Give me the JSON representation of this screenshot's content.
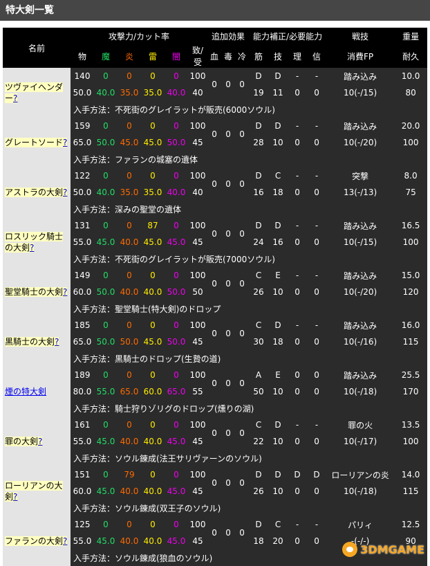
{
  "page": {
    "title": "特大剣一覧"
  },
  "header": {
    "name": "名前",
    "attack_group": "攻撃力/カット率",
    "effect_group": "追加効果",
    "stat_group": "能力補正/必要能力",
    "skill": "戦技",
    "weight": "重量",
    "attack_cols": [
      "物",
      "魔",
      "炎",
      "雷",
      "闇",
      "致/受"
    ],
    "effect_cols": [
      "血",
      "毒",
      "冷"
    ],
    "stat_cols": [
      "筋",
      "技",
      "理",
      "信"
    ],
    "skill_sub": "消費FP",
    "weight_sub": "耐久"
  },
  "weapons": [
    {
      "name": "ツヴァイヘンダー",
      "q": "?",
      "r1": [
        "140",
        "0",
        "0",
        "0",
        "0",
        "100"
      ],
      "eff": [
        "0",
        "0",
        "0"
      ],
      "s1": [
        "D",
        "D",
        "-",
        "-"
      ],
      "skill": "踏み込み",
      "weight": "10.0",
      "r2": [
        "50.0",
        "40.0",
        "35.0",
        "35.0",
        "40.0",
        "40"
      ],
      "s2": [
        "19",
        "11",
        "0",
        "0"
      ],
      "fp": "10(-/15)",
      "dur": "80",
      "acq": "入手方法：不死街のグレイラットが販売(6000ソウル)"
    },
    {
      "name": "グレートソード",
      "q": "?",
      "r1": [
        "159",
        "0",
        "0",
        "0",
        "0",
        "100"
      ],
      "eff": [
        "0",
        "0",
        "0"
      ],
      "s1": [
        "D",
        "D",
        "-",
        "-"
      ],
      "skill": "踏み込み",
      "weight": "20.0",
      "r2": [
        "65.0",
        "50.0",
        "45.0",
        "45.0",
        "50.0",
        "45"
      ],
      "s2": [
        "28",
        "10",
        "0",
        "0"
      ],
      "fp": "10(-/20)",
      "dur": "100",
      "acq": "入手方法：ファランの城塞の遺体"
    },
    {
      "name": "アストラの大剣",
      "q": "?",
      "r1": [
        "122",
        "0",
        "0",
        "0",
        "0",
        "100"
      ],
      "eff": [
        "0",
        "0",
        "0"
      ],
      "s1": [
        "D",
        "C",
        "-",
        "-"
      ],
      "skill": "突撃",
      "weight": "8.0",
      "r2": [
        "50.0",
        "40.0",
        "35.0",
        "35.0",
        "40.0",
        "40"
      ],
      "s2": [
        "16",
        "18",
        "0",
        "0"
      ],
      "fp": "13(-/13)",
      "dur": "75",
      "acq": "入手方法：深みの聖堂の遺体"
    },
    {
      "name": "ロスリック騎士の大剣",
      "q": "?",
      "r1": [
        "131",
        "0",
        "0",
        "87",
        "0",
        "100"
      ],
      "eff": [
        "0",
        "0",
        "0"
      ],
      "s1": [
        "D",
        "D",
        "-",
        "-"
      ],
      "skill": "踏み込み",
      "weight": "16.5",
      "r2": [
        "55.0",
        "45.0",
        "40.0",
        "45.0",
        "45.0",
        "45"
      ],
      "s2": [
        "24",
        "16",
        "0",
        "0"
      ],
      "fp": "10(-/15)",
      "dur": "100",
      "acq": "入手方法：不死街のグレイラットが販売(7000ソウル)"
    },
    {
      "name": "聖堂騎士の大剣",
      "q": "?",
      "r1": [
        "149",
        "0",
        "0",
        "0",
        "0",
        "100"
      ],
      "eff": [
        "0",
        "0",
        "0"
      ],
      "s1": [
        "C",
        "E",
        "-",
        "-"
      ],
      "skill": "踏み込み",
      "weight": "15.0",
      "r2": [
        "60.0",
        "50.0",
        "40.0",
        "40.0",
        "50.0",
        "50"
      ],
      "s2": [
        "26",
        "10",
        "0",
        "0"
      ],
      "fp": "10(-/20)",
      "dur": "120",
      "acq": "入手方法：聖堂騎士(特大剣)のドロップ"
    },
    {
      "name": "黒騎士の大剣",
      "q": "?",
      "r1": [
        "185",
        "0",
        "0",
        "0",
        "0",
        "100"
      ],
      "eff": [
        "0",
        "0",
        "0"
      ],
      "s1": [
        "C",
        "D",
        "-",
        "-"
      ],
      "skill": "踏み込み",
      "weight": "16.0",
      "r2": [
        "65.0",
        "50.0",
        "50.0",
        "45.0",
        "50.0",
        "45"
      ],
      "s2": [
        "30",
        "18",
        "0",
        "0"
      ],
      "fp": "10(-/16)",
      "dur": "115",
      "acq": "入手方法：黒騎士のドロップ(生贄の道)"
    },
    {
      "name": "煙の特大剣",
      "q": "",
      "r1": [
        "189",
        "0",
        "0",
        "0",
        "0",
        "100"
      ],
      "eff": [
        "0",
        "0",
        "0"
      ],
      "s1": [
        "A",
        "E",
        "0",
        "0"
      ],
      "skill": "踏み込み",
      "weight": "25.5",
      "r2": [
        "80.0",
        "55.0",
        "65.0",
        "60.0",
        "65.0",
        "55"
      ],
      "s2": [
        "50",
        "10",
        "0",
        "0"
      ],
      "fp": "10(-/18)",
      "dur": "170",
      "acq": "入手方法：騎士狩りゾリグのドロップ(燻りの湖)"
    },
    {
      "name": "罪の大剣",
      "q": "?",
      "r1": [
        "161",
        "0",
        "0",
        "0",
        "0",
        "100"
      ],
      "eff": [
        "0",
        "0",
        "0"
      ],
      "s1": [
        "C",
        "D",
        "-",
        "-"
      ],
      "skill": "罪の火",
      "weight": "13.5",
      "r2": [
        "55.0",
        "45.0",
        "40.0",
        "40.0",
        "45.0",
        "45"
      ],
      "s2": [
        "22",
        "10",
        "0",
        "0"
      ],
      "fp": "10(-/17)",
      "dur": "100",
      "acq": "入手方法：ソウル錬成(法王サリヴァーンのソウル)"
    },
    {
      "name": "ローリアンの大剣",
      "q": "?",
      "r1": [
        "151",
        "0",
        "79",
        "0",
        "0",
        "100"
      ],
      "eff": [
        "0",
        "0",
        "0"
      ],
      "s1": [
        "D",
        "D",
        "D",
        "D"
      ],
      "skill": "ローリアンの炎",
      "weight": "14.0",
      "r2": [
        "60.0",
        "45.0",
        "40.0",
        "40.0",
        "45.0",
        "45"
      ],
      "s2": [
        "26",
        "10",
        "0",
        "0"
      ],
      "fp": "10(-/18)",
      "dur": "115",
      "acq": "入手方法：ソウル錬成(双王子のソウル)"
    },
    {
      "name": "ファランの大剣",
      "q": "?",
      "r1": [
        "125",
        "0",
        "0",
        "0",
        "0",
        "100"
      ],
      "eff": [
        "0",
        "0",
        "0"
      ],
      "s1": [
        "D",
        "C",
        "-",
        "-"
      ],
      "skill": "パリィ",
      "weight": "12.5",
      "r2": [
        "55.0",
        "45.0",
        "40.0",
        "40.0",
        "45.0",
        "45"
      ],
      "s2": [
        "18",
        "20",
        "0",
        "0"
      ],
      "fp": "-(-/-)",
      "dur": "90",
      "acq": "入手方法：ソウル錬成(狼血のソウル)"
    }
  ],
  "colors": {
    "magic": "#22dd66",
    "fire": "#ff6a00",
    "lightning": "#ffee00",
    "dark": "#ee00ee"
  },
  "watermark": {
    "text": "3DMGAME"
  }
}
